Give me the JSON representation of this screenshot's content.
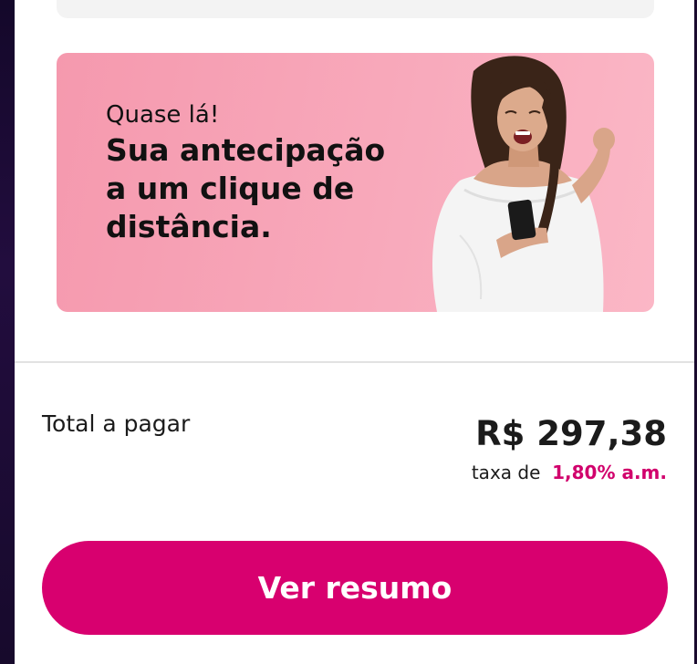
{
  "banner": {
    "kicker": "Quase lá!",
    "headline_line1": "Sua antecipação",
    "headline_line2": "a um clique de",
    "headline_line3": "distância.",
    "background_color": "#f8a9bb"
  },
  "summary": {
    "total_label": "Total a pagar",
    "total_amount": "R$ 297,38",
    "rate_prefix": "taxa de",
    "rate_value": "1,80% a.m.",
    "accent_color": "#d1006c"
  },
  "cta": {
    "label": "Ver resumo",
    "color": "#d8006f"
  }
}
